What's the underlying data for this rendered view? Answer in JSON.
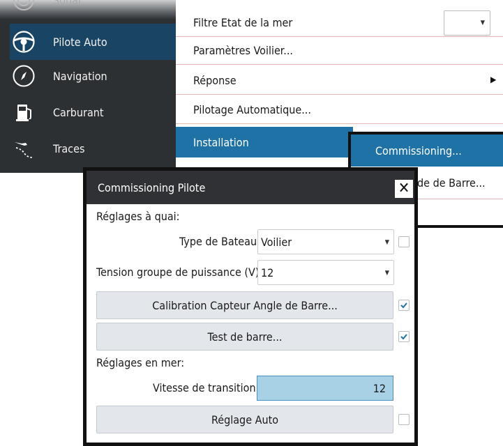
{
  "sidebar": {
    "items": [
      {
        "label": "Sonar",
        "icon": "sonar-icon"
      },
      {
        "label": "Pilote Auto",
        "icon": "steering-wheel-icon",
        "active": true
      },
      {
        "label": "Navigation",
        "icon": "compass-icon"
      },
      {
        "label": "Carburant",
        "icon": "fuel-pump-icon"
      },
      {
        "label": "Traces",
        "icon": "trail-icon"
      }
    ]
  },
  "menu": {
    "filtre": "Filtre Etat de la mer",
    "filtre_value": "",
    "parametres": "Paramètres Voilier...",
    "reponse": "Réponse",
    "pilotage": "Pilotage Automatique...",
    "installation": "Installation"
  },
  "submenu": {
    "commissioning": "Commissioning...",
    "angle_partial": "de de Barre..."
  },
  "dialog": {
    "title": "Commissioning Pilote",
    "section_quai": "Réglages à quai:",
    "boat_type_label": "Type de Bateau",
    "boat_type_value": "Voilier",
    "boat_type_checked": false,
    "voltage_label": "Tension groupe de puissance (V)",
    "voltage_value": "12",
    "calibration_button": "Calibration Capteur Angle de Barre...",
    "calibration_checked": true,
    "test_button": "Test de barre...",
    "test_checked": true,
    "section_mer": "Réglages en mer:",
    "speed_label": "Vitesse de transition",
    "speed_value": "12",
    "auto_button": "Réglage Auto",
    "auto_checked": false
  },
  "colors": {
    "sidebar_bg": "#2d3033",
    "active_item": "#1a4463",
    "highlight": "#1f72a5",
    "field_blue": "#a8d1e6"
  }
}
